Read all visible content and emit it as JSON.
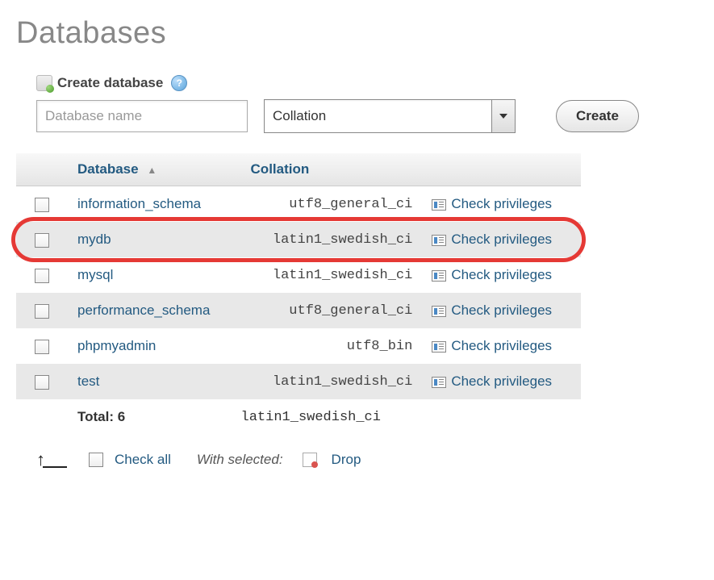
{
  "page": {
    "title": "Databases"
  },
  "create": {
    "heading": "Create database",
    "placeholder": "Database name",
    "collation_placeholder": "Collation",
    "button": "Create"
  },
  "table": {
    "headers": {
      "database": "Database",
      "collation": "Collation"
    },
    "rows": [
      {
        "name": "information_schema",
        "collation": "utf8_general_ci",
        "action": "Check privileges"
      },
      {
        "name": "mydb",
        "collation": "latin1_swedish_ci",
        "action": "Check privileges"
      },
      {
        "name": "mysql",
        "collation": "latin1_swedish_ci",
        "action": "Check privileges"
      },
      {
        "name": "performance_schema",
        "collation": "utf8_general_ci",
        "action": "Check privileges"
      },
      {
        "name": "phpmyadmin",
        "collation": "utf8_bin",
        "action": "Check privileges"
      },
      {
        "name": "test",
        "collation": "latin1_swedish_ci",
        "action": "Check privileges"
      }
    ],
    "total_label": "Total: 6",
    "total_collation": "latin1_swedish_ci"
  },
  "footer": {
    "check_all": "Check all",
    "with_selected": "With selected:",
    "drop": "Drop"
  },
  "highlight_row_index": 1
}
